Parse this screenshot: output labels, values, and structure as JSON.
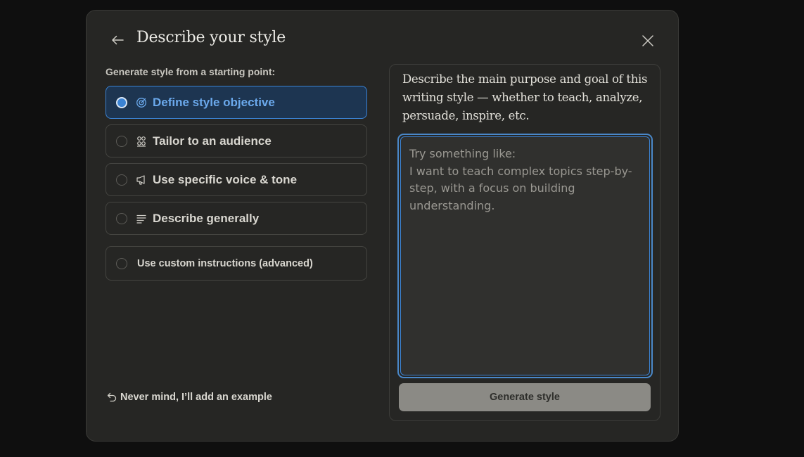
{
  "dialog": {
    "title": "Describe your style"
  },
  "left": {
    "section_label": "Generate style from a starting point:",
    "options": [
      {
        "label": "Define style objective",
        "icon": "target-icon",
        "selected": true
      },
      {
        "label": "Tailor to an audience",
        "icon": "people-icon",
        "selected": false
      },
      {
        "label": "Use specific voice & tone",
        "icon": "megaphone-icon",
        "selected": false
      },
      {
        "label": "Describe generally",
        "icon": "text-lines-icon",
        "selected": false
      },
      {
        "label": "Use custom instructions (advanced)",
        "selected": false
      }
    ],
    "back_link": "Never mind, I’ll add an example"
  },
  "right": {
    "prompt": "Describe the main purpose and goal of this writing style — whether to teach, analyze, persuade, inspire, etc.",
    "textarea_value": "",
    "textarea_placeholder": "Try something like:\nI want to teach complex topics step-by-step, with a focus on building understanding.",
    "generate_label": "Generate style"
  },
  "colors": {
    "accent": "#3b83d4",
    "selected_bg": "#1d3551",
    "modal_bg": "#262624",
    "page_bg": "#0f0f0f"
  }
}
